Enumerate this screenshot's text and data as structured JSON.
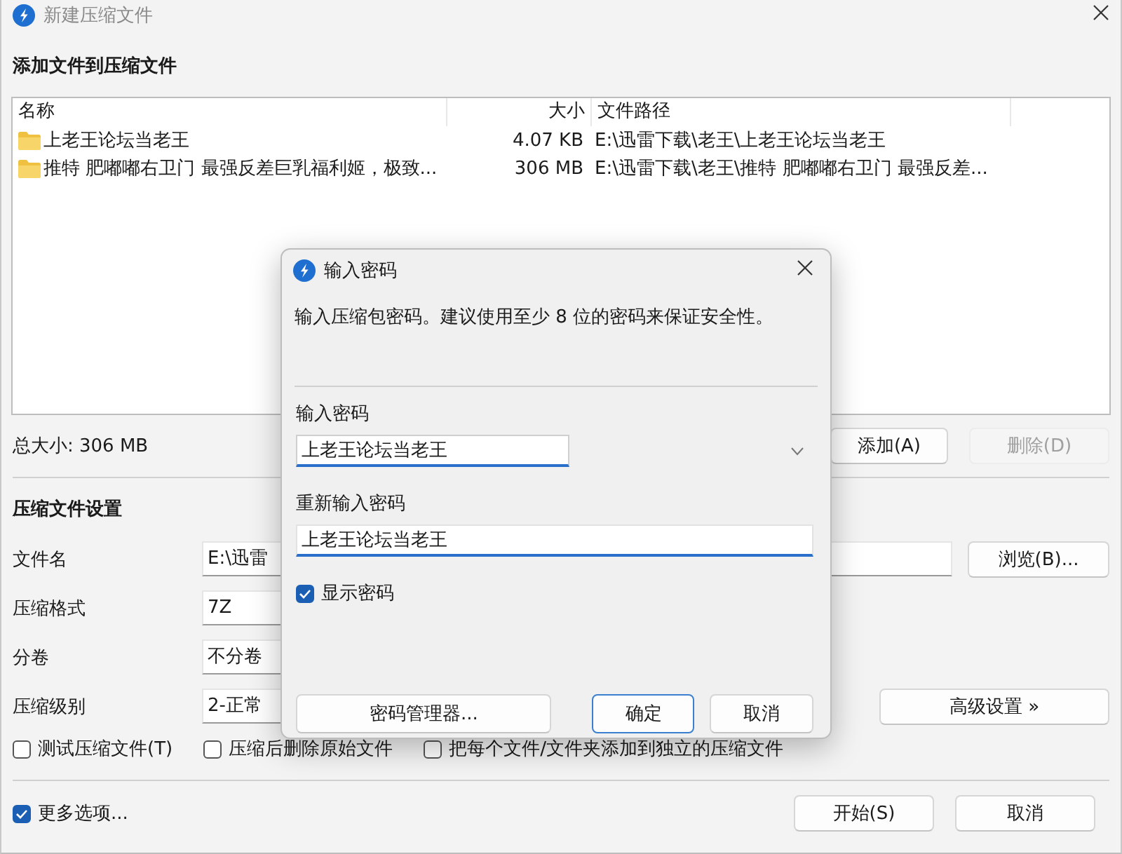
{
  "window": {
    "title": "新建压缩文件"
  },
  "files": {
    "heading": "添加文件到压缩文件",
    "columns": [
      "名称",
      "大小",
      "文件路径"
    ],
    "rows": [
      {
        "name": "上老王论坛当老王",
        "size": "4.07 KB",
        "path": "E:\\迅雷下载\\老王\\上老王论坛当老王"
      },
      {
        "name": "推特 肥嘟嘟右卫门 最强反差巨乳福利姬，极致...",
        "size": "306 MB",
        "path": "E:\\迅雷下载\\老王\\推特 肥嘟嘟右卫门 最强反差..."
      }
    ],
    "total": "总大小: 306 MB",
    "buttons": [
      {
        "label": "添加(A)",
        "disabled": false
      },
      {
        "label": "删除(D)",
        "disabled": true
      }
    ]
  },
  "settings": {
    "heading": "压缩文件设置",
    "fields": [
      {
        "label": "文件名",
        "value": "E:\\迅雷",
        "button": "浏览(B)..."
      },
      {
        "label": "压缩格式",
        "value": "7Z"
      },
      {
        "label": "分卷",
        "value": "不分卷"
      },
      {
        "label": "压缩级别",
        "value": "2-正常",
        "button": "高级设置 »"
      }
    ],
    "options": [
      {
        "label": "测试压缩文件(T)",
        "checked": false
      },
      {
        "label": "压缩后删除原始文件",
        "checked": false
      },
      {
        "label": "把每个文件/文件夹添加到独立的压缩文件",
        "checked": false
      }
    ]
  },
  "more_options": {
    "label": "更多选项...",
    "checked": true
  },
  "buttons": [
    "开始(S)",
    "取消"
  ],
  "dialog": {
    "title": "输入密码",
    "message": "输入压缩包密码。建议使用至少 8 位的密码来保证安全性。",
    "password_label": "输入密码",
    "password": "上老王论坛当老王",
    "confirm_label": "重新输入密码",
    "confirm": "上老王论坛当老王",
    "show_password": {
      "label": "显示密码",
      "checked": true
    },
    "buttons": [
      {
        "label": "密码管理器...",
        "default": false
      },
      {
        "label": "确定",
        "default": true
      },
      {
        "label": "取消",
        "default": false
      }
    ]
  }
}
